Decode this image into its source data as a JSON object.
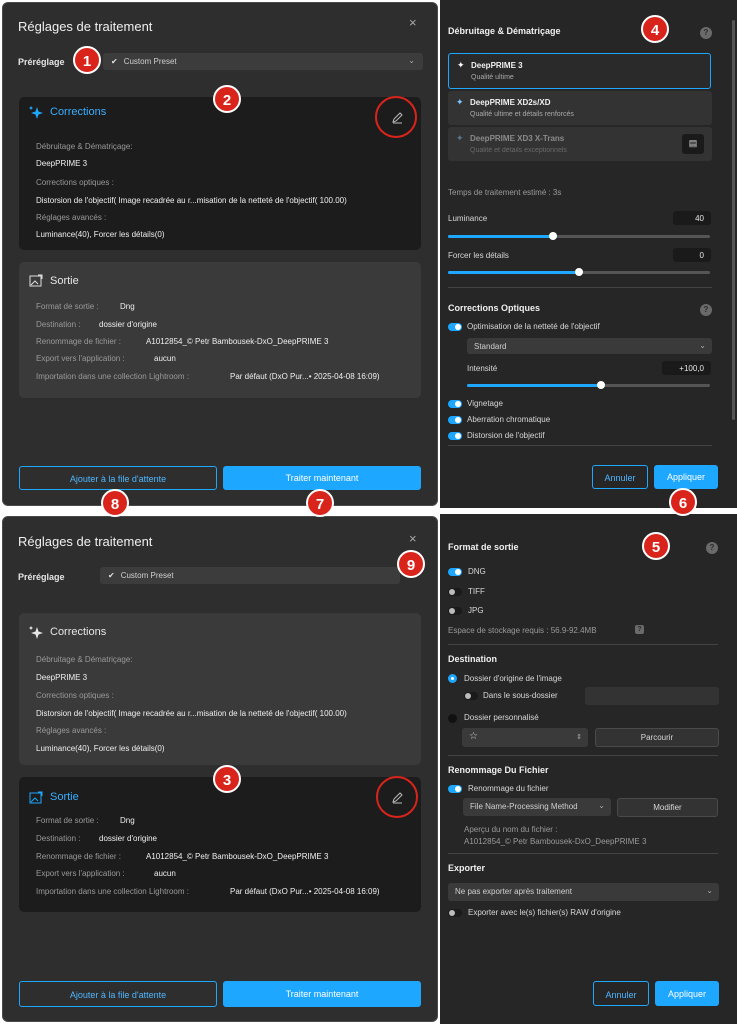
{
  "top": {
    "dialog": {
      "title": "Réglages de traitement",
      "close": "×",
      "preset_label": "Préréglage",
      "preset_value": "Custom Preset",
      "corrections": {
        "title": "Corrections",
        "k1": "Débruitage & Dématriçage:",
        "v1": "DeepPRIME 3",
        "k2": "Corrections optiques :",
        "v2": "Distorsion de l'objectif( Image recadrée au r...misation de la netteté de l'objectif( 100.00)",
        "k3": "Réglages avancés :",
        "v3": "Luminance(40), Forcer les détails(0)"
      },
      "sortie": {
        "title": "Sortie",
        "r1k": "Format de sortie :",
        "r1v": "Dng",
        "r2k": "Destination :",
        "r2v": "dossier d'origine",
        "r3k": "Renommage de fichier :",
        "r3v": "A1012854_© Petr Bambousek-DxO_DeepPRIME 3",
        "r4k": "Export vers l'application :",
        "r4v": "aucun",
        "r5k": "Importation dans une collection Lightroom :",
        "r5v": "Par défaut (DxO Pur...• 2025-04-08 16:09)"
      },
      "queue_button": "Ajouter à la file d'attente",
      "process_button": "Traiter maintenant"
    },
    "right": {
      "title": "Débruitage & Dématriçage",
      "help": "?",
      "options": [
        {
          "name": "DeepPRIME 3",
          "desc": "Qualité ultime"
        },
        {
          "name": "DeepPRIME XD2s/XD",
          "desc": "Qualité ultime et détails renforcés"
        },
        {
          "name": "DeepPRIME XD3 X-Trans",
          "desc": "Qualité et détails exceptionnels"
        }
      ],
      "time_label": "Temps de traitement estimé : 3s",
      "luminance_label": "Luminance",
      "luminance_value": "40",
      "luminance_fraction": 0.4,
      "details_label": "Forcer les détails",
      "details_value": "0",
      "details_fraction": 0.5,
      "optics_title": "Corrections Optiques",
      "sharpen_label": "Optimisation de la netteté de l'objectif",
      "sharpen_mode": "Standard",
      "intensity_label": "Intensité",
      "intensity_value": "+100,0",
      "intensity_fraction": 0.55,
      "vignetting": "Vignetage",
      "chromatic": "Aberration chromatique",
      "distortion": "Distorsion de l'objectif",
      "cancel": "Annuler",
      "apply": "Appliquer"
    }
  },
  "bottom": {
    "dialog": {
      "title": "Réglages de traitement",
      "close": "×",
      "preset_label": "Préréglage",
      "preset_value": "Custom Preset",
      "corrections": {
        "title": "Corrections",
        "k1": "Débruitage & Dématriçage:",
        "v1": "DeepPRIME 3",
        "k2": "Corrections optiques :",
        "v2": "Distorsion de l'objectif( Image recadrée au r...misation de la netteté de l'objectif( 100.00)",
        "k3": "Réglages avancés :",
        "v3": "Luminance(40), Forcer les détails(0)"
      },
      "sortie": {
        "title": "Sortie",
        "r1k": "Format de sortie :",
        "r1v": "Dng",
        "r2k": "Destination :",
        "r2v": "dossier d'origine",
        "r3k": "Renommage de fichier :",
        "r3v": "A1012854_© Petr Bambousek-DxO_DeepPRIME 3",
        "r4k": "Export vers l'application :",
        "r4v": "aucun",
        "r5k": "Importation dans une collection Lightroom :",
        "r5v": "Par défaut (DxO Pur...• 2025-04-08 16:09)"
      },
      "queue_button": "Ajouter à la file d'attente",
      "process_button": "Traiter maintenant"
    },
    "right": {
      "title": "Format de sortie",
      "help": "?",
      "dng": "DNG",
      "tiff": "TIFF",
      "jpg": "JPG",
      "storage": "Espace de stockage requis : 56.9-92.4MB",
      "storage_help": "?",
      "dest_title": "Destination",
      "dest_origin": "Dossier d'origine de l'image",
      "dest_sub": "Dans le sous-dossier",
      "dest_custom": "Dossier personnalisé",
      "browse": "Parcourir",
      "rename_title": "Renommage Du Fichier",
      "rename_toggle": "Renommage du fichier",
      "rename_method": "File Name-Processing Method",
      "modify": "Modifier",
      "preview_label": "Aperçu du nom du fichier :",
      "preview_value": "A1012854_© Petr Bambousek-DxO_DeepPRIME 3",
      "export_title": "Exporter",
      "export_option": "Ne pas exporter après traitement",
      "export_raw": "Exporter avec le(s) fichier(s) RAW d'origine",
      "cancel": "Annuler",
      "apply": "Appliquer"
    }
  },
  "markers": [
    "1",
    "2",
    "3",
    "4",
    "5",
    "6",
    "7",
    "8",
    "9"
  ],
  "colors": {
    "accent": "#1ea7ff",
    "marker": "#d9241c"
  }
}
